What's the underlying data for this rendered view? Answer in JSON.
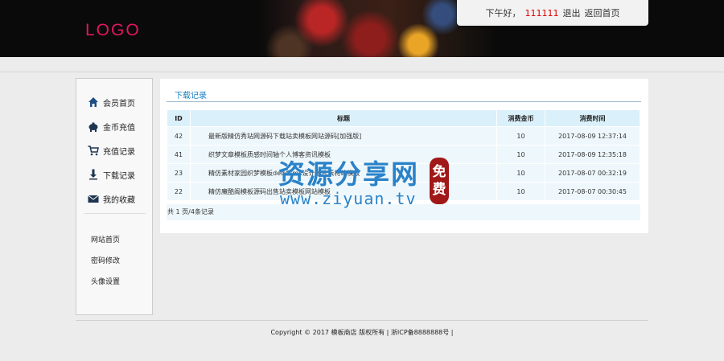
{
  "header": {
    "logo": "LOGO",
    "greeting": "下午好，",
    "username": "111111",
    "logout_label": "退出",
    "home_label": "返回首页"
  },
  "sidebar": {
    "items": [
      {
        "label": "会员首页",
        "icon": "home-icon"
      },
      {
        "label": "金币充值",
        "icon": "piggy-bank-icon"
      },
      {
        "label": "充值记录",
        "icon": "cart-icon"
      },
      {
        "label": "下载记录",
        "icon": "download-icon"
      },
      {
        "label": "我的收藏",
        "icon": "mail-icon"
      }
    ],
    "links": [
      {
        "label": "网站首页"
      },
      {
        "label": "密码修改"
      },
      {
        "label": "头像设置"
      }
    ]
  },
  "panel": {
    "title": "下载记录",
    "columns": [
      "ID",
      "标题",
      "消费金币",
      "消费时间"
    ],
    "rows": [
      {
        "id": "42",
        "title": "最新版精仿秀站网源码下载站卖模板网站源码[加强版]",
        "coins": "10",
        "time": "2017-08-09 12:37:14"
      },
      {
        "id": "41",
        "title": "织梦文章模板质感时间轴个人博客资讯模板",
        "coins": "10",
        "time": "2017-08-09 12:35:18"
      },
      {
        "id": "23",
        "title": "精仿素材家园织梦模板dedecms设计图片素材站模板",
        "coins": "10",
        "time": "2017-08-07 00:32:19"
      },
      {
        "id": "22",
        "title": "精仿魔酷阁模板源码出售站卖模板网站模板",
        "coins": "10",
        "time": "2017-08-07 00:30:45"
      }
    ],
    "pager": "共 1 页/4条记录"
  },
  "watermark": {
    "main": "资源分享网",
    "url": "www.ziyuan.tv",
    "stamp_1": "免",
    "stamp_2": "费"
  },
  "footer": {
    "text": "Copyright © 2017 模板商店 版权所有 | 浙ICP备8888888号 |"
  },
  "colors": {
    "logo": "#e0165e",
    "accent": "#1a7fc2",
    "table_header": "#daf0fa",
    "table_row": "#eef8fc",
    "username": "#dd0000"
  }
}
